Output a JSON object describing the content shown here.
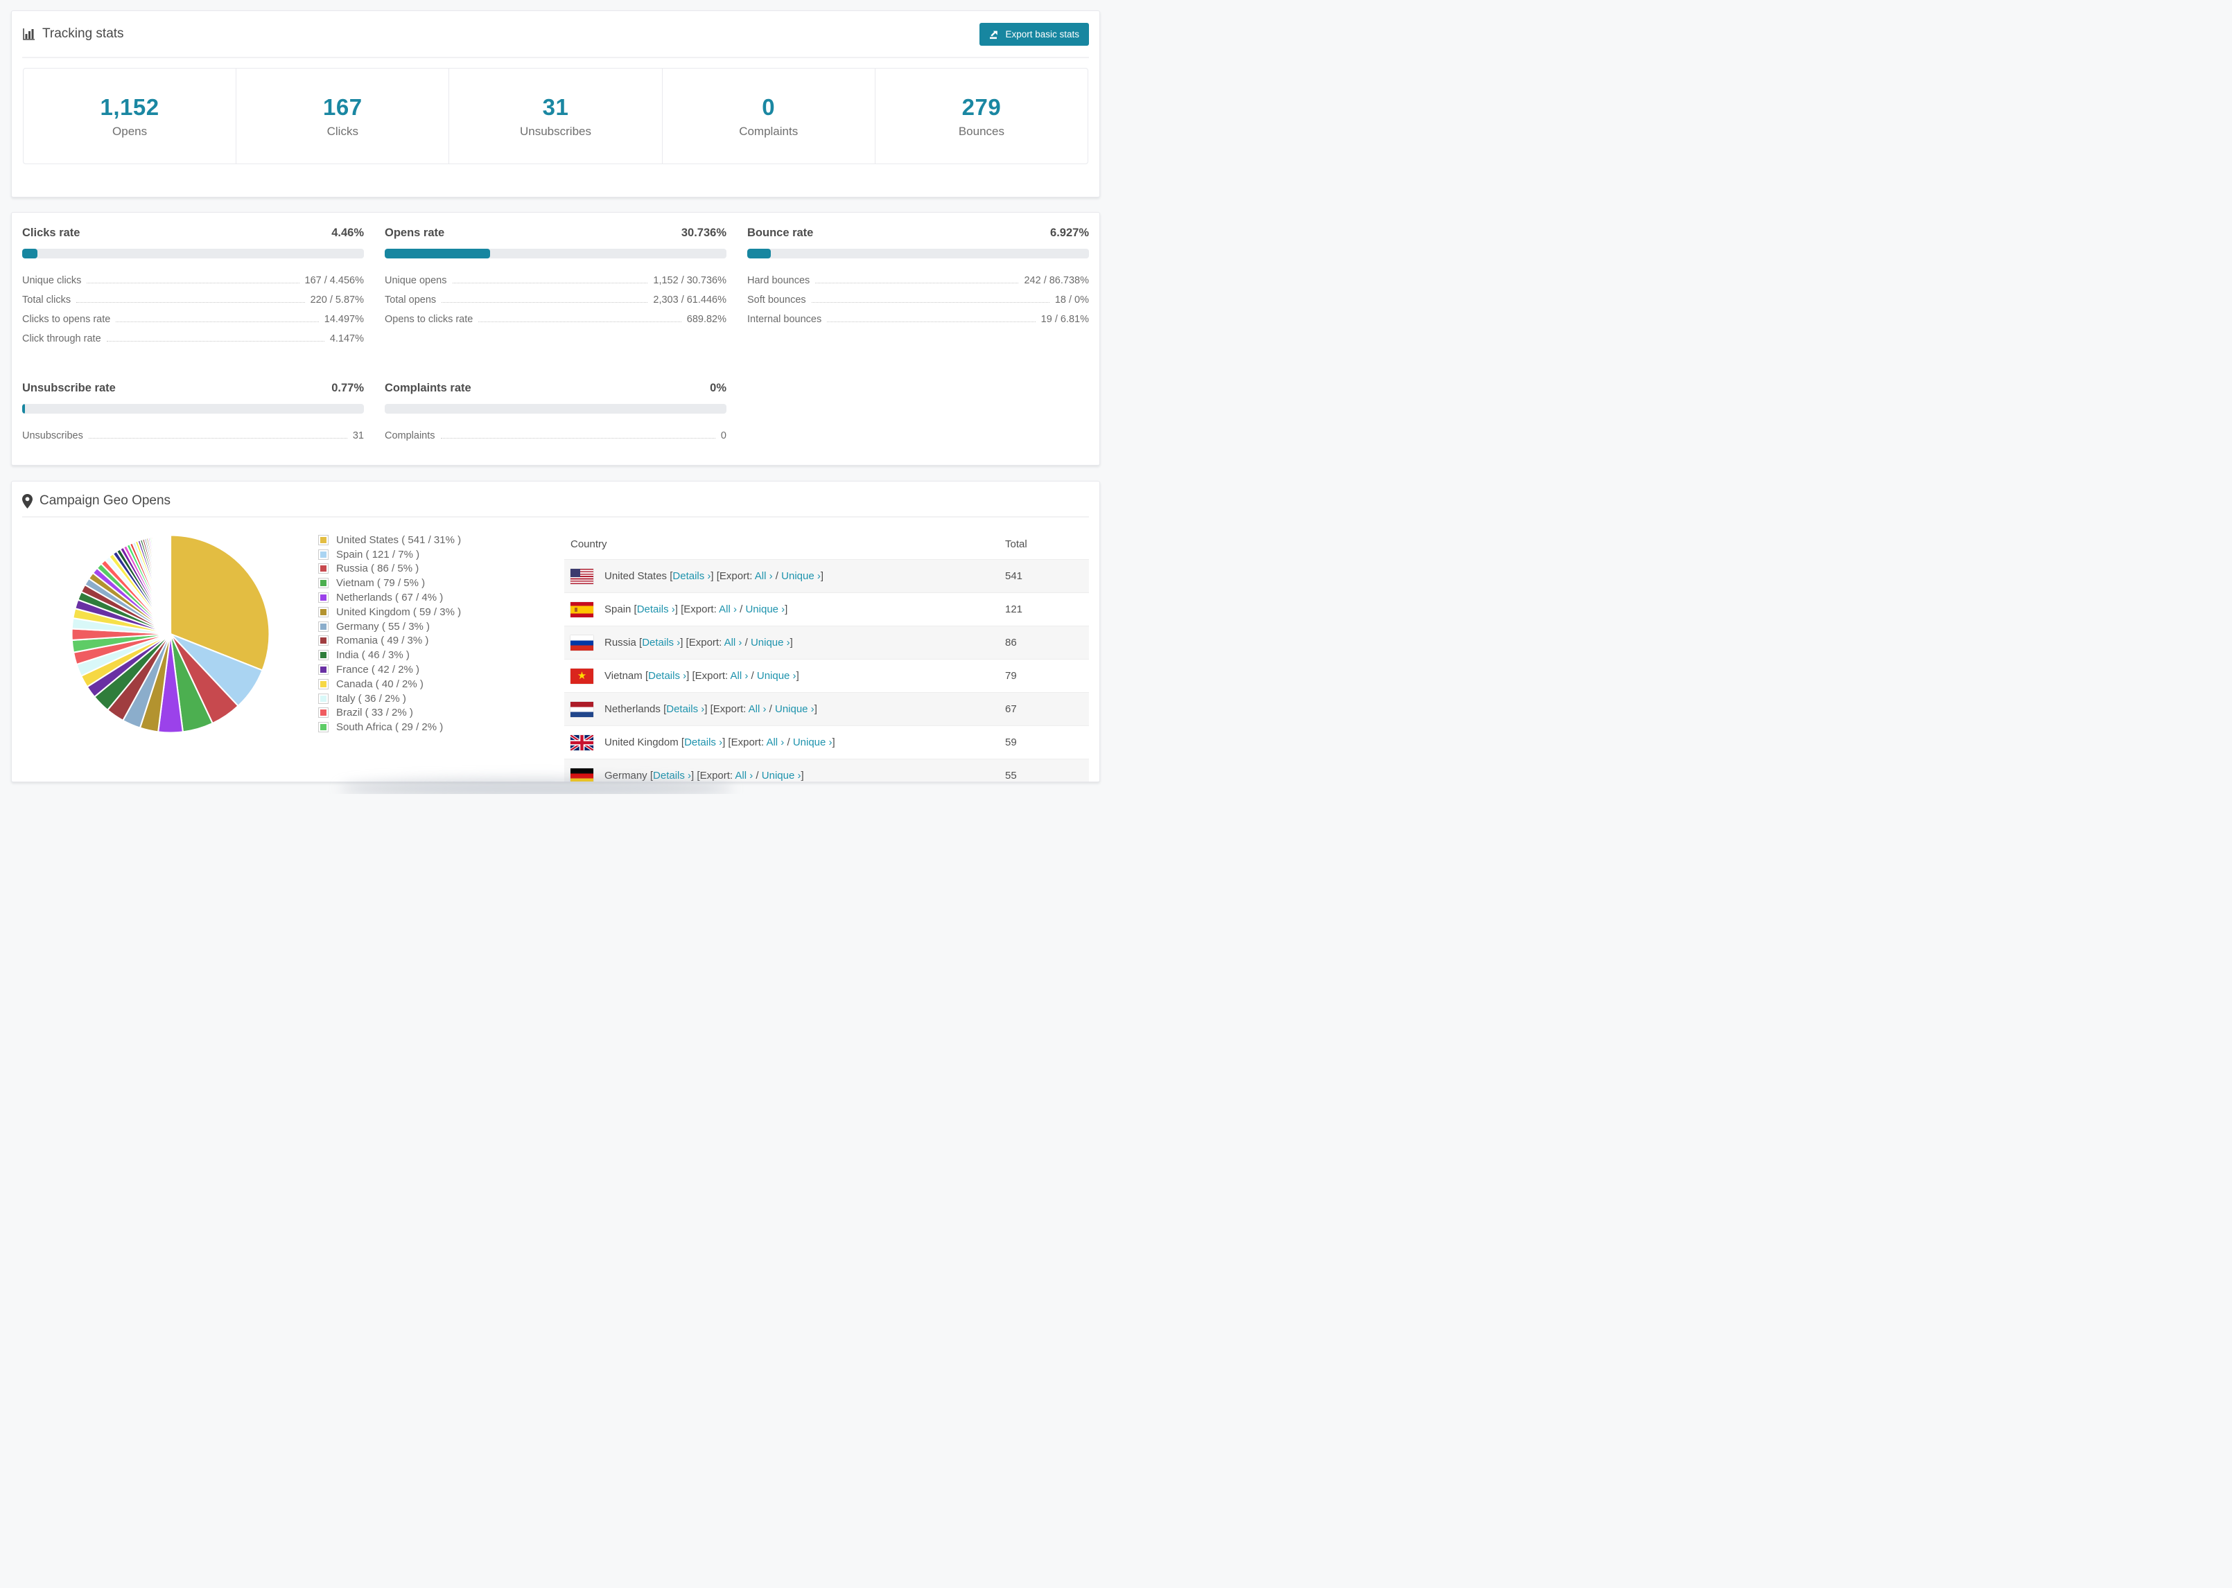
{
  "accent": "#1786a0",
  "link_color": "#1e93ad",
  "page_bg": "#f7f8f9",
  "tracking": {
    "title": "Tracking stats",
    "export_button": "Export basic stats",
    "stats": [
      {
        "value": "1,152",
        "label": "Opens"
      },
      {
        "value": "167",
        "label": "Clicks"
      },
      {
        "value": "31",
        "label": "Unsubscribes"
      },
      {
        "value": "0",
        "label": "Complaints"
      },
      {
        "value": "279",
        "label": "Bounces"
      }
    ]
  },
  "rates": [
    {
      "title": "Clicks rate",
      "value": "4.46%",
      "percent": 4.46,
      "rows": [
        {
          "label": "Unique clicks",
          "value": "167 / 4.456%"
        },
        {
          "label": "Total clicks",
          "value": "220 / 5.87%"
        },
        {
          "label": "Clicks to opens rate",
          "value": "14.497%"
        },
        {
          "label": "Click through rate",
          "value": "4.147%"
        }
      ]
    },
    {
      "title": "Opens rate",
      "value": "30.736%",
      "percent": 30.736,
      "rows": [
        {
          "label": "Unique opens",
          "value": "1,152 / 30.736%"
        },
        {
          "label": "Total opens",
          "value": "2,303 / 61.446%"
        },
        {
          "label": "Opens to clicks rate",
          "value": "689.82%"
        }
      ]
    },
    {
      "title": "Bounce rate",
      "value": "6.927%",
      "percent": 6.927,
      "rows": [
        {
          "label": "Hard bounces",
          "value": "242 / 86.738%"
        },
        {
          "label": "Soft bounces",
          "value": "18 / 0%"
        },
        {
          "label": "Internal bounces",
          "value": "19 / 6.81%"
        }
      ]
    },
    {
      "title": "Unsubscribe rate",
      "value": "0.77%",
      "percent": 0.77,
      "rows": [
        {
          "label": "Unsubscribes",
          "value": "31"
        }
      ]
    },
    {
      "title": "Complaints rate",
      "value": "0%",
      "percent": 0,
      "rows": [
        {
          "label": "Complaints",
          "value": "0"
        }
      ]
    }
  ],
  "geo": {
    "title": "Campaign Geo Opens",
    "table": {
      "headers": [
        "Country",
        "Total"
      ],
      "link_parts": {
        "open": "[",
        "close": "]",
        "details": "Details ›",
        "export": "Export:",
        "all": "All ›",
        "slash": "/",
        "unique": "Unique ›"
      },
      "rows": [
        {
          "country": "United States",
          "flag": "us",
          "total": "541"
        },
        {
          "country": "Spain",
          "flag": "es",
          "total": "121"
        },
        {
          "country": "Russia",
          "flag": "ru",
          "total": "86"
        },
        {
          "country": "Vietnam",
          "flag": "vn",
          "total": "79"
        },
        {
          "country": "Netherlands",
          "flag": "nl",
          "total": "67"
        },
        {
          "country": "United Kingdom",
          "flag": "gb",
          "total": "59"
        },
        {
          "country": "Germany",
          "flag": "de",
          "total": "55"
        }
      ]
    }
  },
  "chart_data": {
    "type": "pie",
    "title": "Campaign Geo Opens",
    "unit": "opens",
    "legend_position": "right",
    "start_angle_deg": 0,
    "direction": "clockwise",
    "slices": [
      {
        "label": "United States",
        "value": 541,
        "pct": 31,
        "color": "#e3bd42"
      },
      {
        "label": "Spain",
        "value": 121,
        "pct": 7,
        "color": "#aad4f2"
      },
      {
        "label": "Russia",
        "value": 86,
        "pct": 5,
        "color": "#c7494e"
      },
      {
        "label": "Vietnam",
        "value": 79,
        "pct": 5,
        "color": "#4caf50"
      },
      {
        "label": "Netherlands",
        "value": 67,
        "pct": 4,
        "color": "#9b42ea"
      },
      {
        "label": "United Kingdom",
        "value": 59,
        "pct": 3,
        "color": "#b3932f"
      },
      {
        "label": "Germany",
        "value": 55,
        "pct": 3,
        "color": "#8badcb"
      },
      {
        "label": "Romania",
        "value": 49,
        "pct": 3,
        "color": "#a03d40"
      },
      {
        "label": "India",
        "value": 46,
        "pct": 3,
        "color": "#2f7d3b"
      },
      {
        "label": "France",
        "value": 42,
        "pct": 2,
        "color": "#6930a3"
      },
      {
        "label": "Canada",
        "value": 40,
        "pct": 2,
        "color": "#f6d844"
      },
      {
        "label": "Italy",
        "value": 36,
        "pct": 2,
        "color": "#d9f8f8"
      },
      {
        "label": "Brazil",
        "value": 33,
        "pct": 2,
        "color": "#f05c60"
      },
      {
        "label": "South Africa",
        "value": 29,
        "pct": 2,
        "color": "#5ecc66"
      }
    ],
    "others_pct_total": 26,
    "others_palette": [
      "#f05c60",
      "#d9f8f8",
      "#f6e04a",
      "#6930a3",
      "#2f7d3b",
      "#9c3a3e",
      "#8badcb",
      "#b3932f",
      "#a346ee",
      "#56cc63",
      "#ff5c5c",
      "#eefcff",
      "#f9ed4e",
      "#2e3192",
      "#1e5c2f",
      "#7a1fa8",
      "#e24fd0",
      "#49e06a",
      "#e8413c",
      "#cfeff7",
      "#f2ef3a",
      "#5a2d9e",
      "#276b31",
      "#8a2f33",
      "#7797b5",
      "#9c7f22",
      "#b95ef0",
      "#63e373"
    ]
  }
}
